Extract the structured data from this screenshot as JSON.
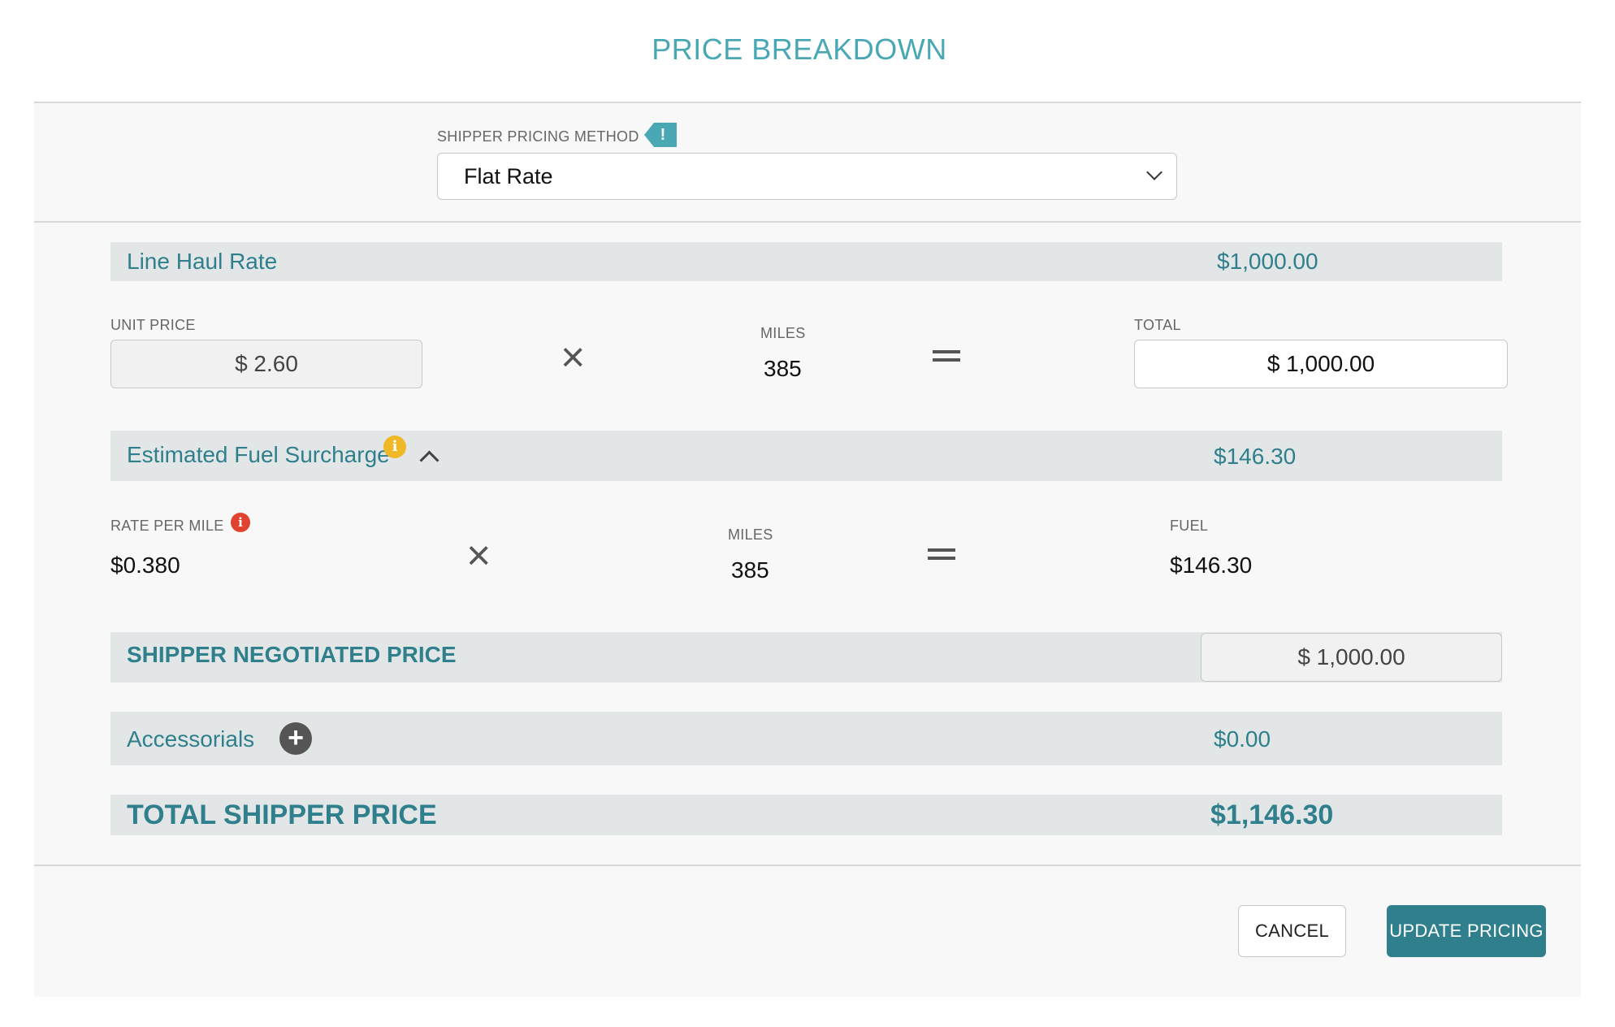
{
  "title": "PRICE BREAKDOWN",
  "pricing_method": {
    "label": "SHIPPER PRICING METHOD",
    "tag_icon_text": "!",
    "selected": "Flat Rate"
  },
  "line_haul": {
    "label": "Line Haul Rate",
    "value": "$1,000.00",
    "unit_price_label": "UNIT PRICE",
    "unit_price": "$ 2.60",
    "miles_label": "MILES",
    "miles": "385",
    "total_label": "TOTAL",
    "total": "$ 1,000.00"
  },
  "fuel": {
    "label": "Estimated Fuel Surcharge",
    "value": "$146.30",
    "rate_label": "RATE PER MILE",
    "rate": "$0.380",
    "miles_label": "MILES",
    "miles": "385",
    "fuel_label": "FUEL",
    "fuel": "$146.30",
    "info_icon_text": "i"
  },
  "negotiated": {
    "label": "SHIPPER NEGOTIATED PRICE",
    "value": "$ 1,000.00"
  },
  "accessorials": {
    "label": "Accessorials",
    "value": "$0.00",
    "plus_text": "+"
  },
  "total": {
    "label": "TOTAL SHIPPER PRICE",
    "value": "$1,146.30"
  },
  "buttons": {
    "cancel": "CANCEL",
    "update": "UPDATE PRICING"
  },
  "operators": {
    "times": "×"
  },
  "colors": {
    "accent": "#4aa8b5",
    "teal_dark": "#2f7f8c",
    "band_bg": "#e2e6e7",
    "warning": "#f0b826",
    "error": "#e0432f"
  }
}
